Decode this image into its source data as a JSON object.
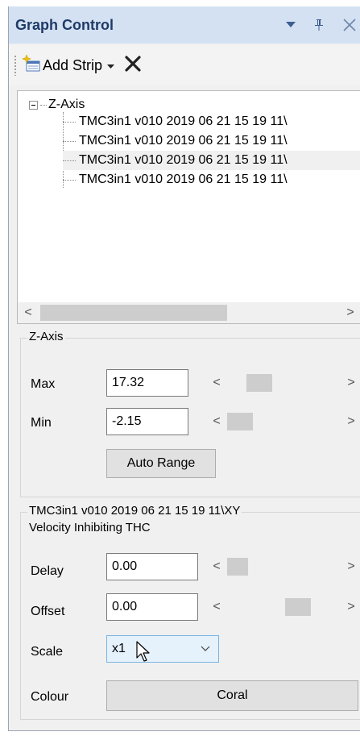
{
  "panel": {
    "title": "Graph Control",
    "icons": [
      "dropdown-icon",
      "pin-icon",
      "close-icon"
    ]
  },
  "toolbar": {
    "add_strip_label": "Add Strip",
    "icons": [
      "add-strip-icon",
      "delete-icon"
    ]
  },
  "tree": {
    "root_label": "Z-Axis",
    "items": [
      "TMC3in1 v010  2019 06 21  15 19 11\\",
      "TMC3in1 v010  2019 06 21  15 19 11\\",
      "TMC3in1 v010  2019 06 21  15 19 11\\",
      "TMC3in1 v010  2019 06 21  15 19 11\\"
    ],
    "selected_index": 2
  },
  "axis_group": {
    "title": "Z-Axis",
    "max_label": "Max",
    "max_value": "17.32",
    "min_label": "Min",
    "min_value": "-2.15",
    "auto_range_label": "Auto Range"
  },
  "series_group": {
    "title": "TMC3in1 v010  2019 06 21  15 19 11\\XY",
    "subtitle": "Velocity Inhibiting THC",
    "delay_label": "Delay",
    "delay_value": "0.00",
    "offset_label": "Offset",
    "offset_value": "0.00",
    "scale_label": "Scale",
    "scale_value": "x1",
    "colour_label": "Colour",
    "colour_value": "Coral"
  },
  "colors": {
    "title_bar": "#d4e1f3",
    "title_text": "#1e3a66",
    "panel_bg": "#f0f0f0",
    "combo_highlight": "#e5f1fb"
  }
}
